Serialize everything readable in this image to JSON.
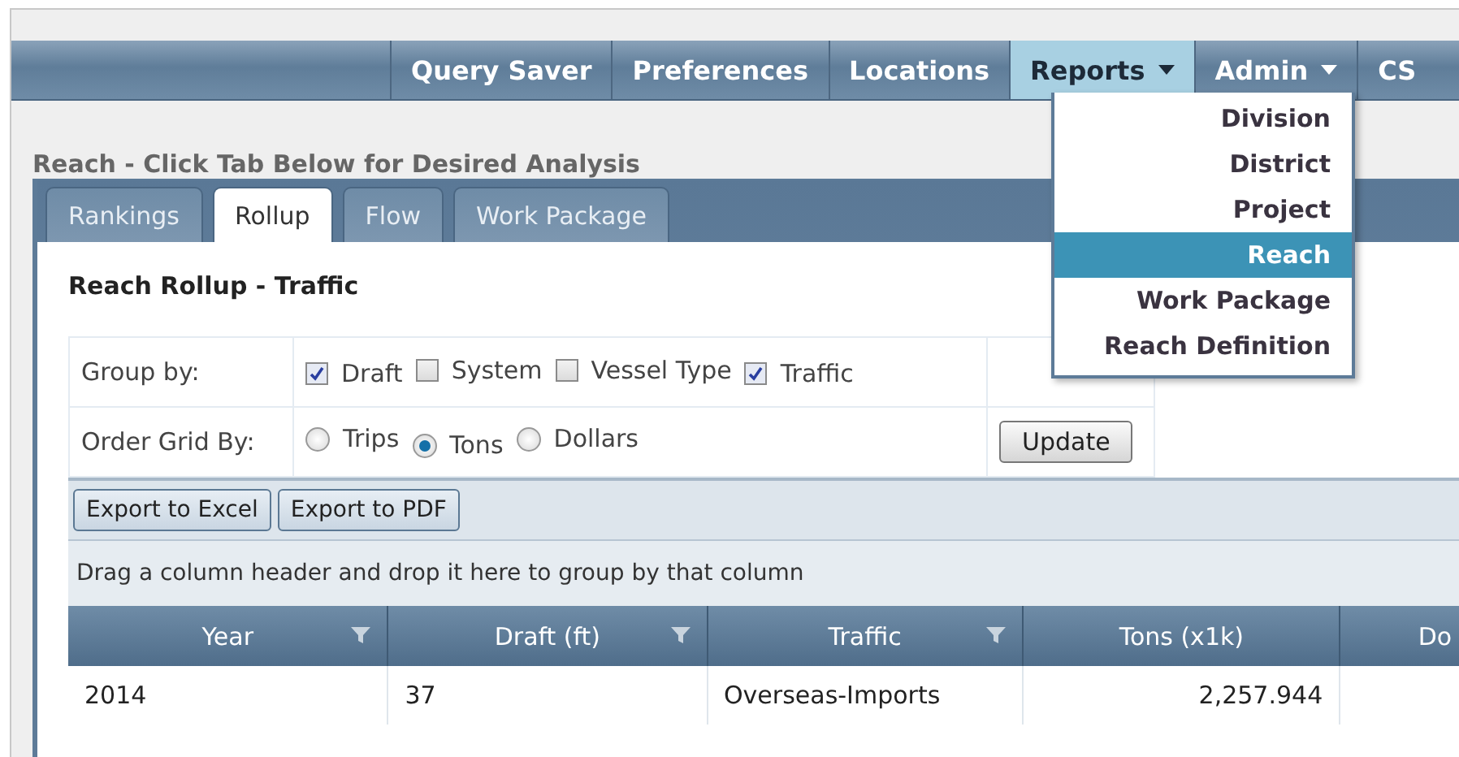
{
  "nav": {
    "items": [
      {
        "label": "Query Saver",
        "dropdown": false,
        "selected": false
      },
      {
        "label": "Preferences",
        "dropdown": false,
        "selected": false
      },
      {
        "label": "Locations",
        "dropdown": false,
        "selected": false
      },
      {
        "label": "Reports",
        "dropdown": true,
        "selected": true
      },
      {
        "label": "Admin",
        "dropdown": true,
        "selected": false
      },
      {
        "label": "CS",
        "dropdown": false,
        "selected": false
      }
    ]
  },
  "menu": {
    "items": [
      {
        "label": "Division",
        "selected": false
      },
      {
        "label": "District",
        "selected": false
      },
      {
        "label": "Project",
        "selected": false
      },
      {
        "label": "Reach",
        "selected": true
      },
      {
        "label": "Work Package",
        "selected": false
      },
      {
        "label": "Reach Definition",
        "selected": false
      }
    ]
  },
  "page_title": "Reach - Click Tab Below for Desired Analysis",
  "tabs": [
    {
      "label": "Rankings",
      "selected": false
    },
    {
      "label": "Rollup",
      "selected": true
    },
    {
      "label": "Flow",
      "selected": false
    },
    {
      "label": "Work Package",
      "selected": false
    }
  ],
  "section_title": "Reach Rollup - Traffic",
  "group_by": {
    "label": "Group by:",
    "options": [
      {
        "label": "Draft",
        "checked": true
      },
      {
        "label": "System",
        "checked": false
      },
      {
        "label": "Vessel Type",
        "checked": false
      },
      {
        "label": "Traffic",
        "checked": true
      }
    ]
  },
  "order_by": {
    "label": "Order Grid By:",
    "options": [
      {
        "label": "Trips",
        "selected": false
      },
      {
        "label": "Tons",
        "selected": true
      },
      {
        "label": "Dollars",
        "selected": false
      }
    ]
  },
  "update_button": "Update",
  "toolbar": {
    "buttons": [
      "Export to Excel",
      "Export to PDF"
    ]
  },
  "group_hint": "Drag a column header and drop it here to group by that column",
  "grid": {
    "columns": [
      {
        "label": "Year",
        "filter": true,
        "kind": "text"
      },
      {
        "label": "Draft (ft)",
        "filter": true,
        "kind": "text"
      },
      {
        "label": "Traffic",
        "filter": true,
        "kind": "text"
      },
      {
        "label": "Tons (x1k)",
        "filter": false,
        "kind": "number"
      },
      {
        "label": "Do"
      }
    ],
    "rows": [
      {
        "cells": [
          "2014",
          "37",
          "Overseas-Imports",
          "2,257.944"
        ]
      }
    ]
  }
}
